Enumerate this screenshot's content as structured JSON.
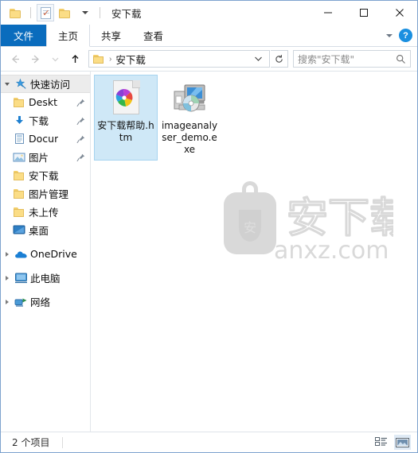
{
  "window": {
    "title": "安下载",
    "quick_access_toolbar": [
      {
        "name": "folder-icon",
        "label": ""
      },
      {
        "name": "properties-icon",
        "label": ""
      },
      {
        "name": "new-folder-icon",
        "label": ""
      },
      {
        "name": "customize-dropdown",
        "label": ""
      }
    ],
    "controls": {
      "minimize": "—",
      "maximize": "□",
      "close": "✕"
    }
  },
  "ribbon": {
    "tabs": [
      {
        "label": "文件",
        "state": "file"
      },
      {
        "label": "主页",
        "state": "active"
      },
      {
        "label": "共享",
        "state": "normal"
      },
      {
        "label": "查看",
        "state": "normal"
      }
    ],
    "collapse_label": "",
    "help_label": "?"
  },
  "address": {
    "back_label": "←",
    "forward_label": "→",
    "history_label": "⌄",
    "up_label": "↑",
    "separator": "›",
    "crumb": "安下载",
    "dropdown_label": "⌄",
    "refresh_label": "↻"
  },
  "search": {
    "placeholder": "搜索\"安下载\"",
    "value": "",
    "icon": "search-icon"
  },
  "sidebar": {
    "items": [
      {
        "label": "快速访问",
        "icon": "star-pin-icon",
        "expander": "down",
        "indent": false,
        "pinned": false,
        "highlight": true
      },
      {
        "label": "Deskt",
        "icon": "folder-icon",
        "expander": "none",
        "indent": true,
        "pinned": true,
        "highlight": false
      },
      {
        "label": "下载",
        "icon": "download-arrow-icon",
        "expander": "none",
        "indent": true,
        "pinned": true,
        "highlight": false
      },
      {
        "label": "Docur",
        "icon": "documents-icon",
        "expander": "none",
        "indent": true,
        "pinned": true,
        "highlight": false
      },
      {
        "label": "图片",
        "icon": "pictures-icon",
        "expander": "none",
        "indent": true,
        "pinned": true,
        "highlight": false
      },
      {
        "label": "安下载",
        "icon": "folder-icon",
        "expander": "none",
        "indent": true,
        "pinned": false,
        "highlight": false
      },
      {
        "label": "图片管理",
        "icon": "folder-icon",
        "expander": "none",
        "indent": true,
        "pinned": false,
        "highlight": false
      },
      {
        "label": "未上传",
        "icon": "folder-icon",
        "expander": "none",
        "indent": true,
        "pinned": false,
        "highlight": false
      },
      {
        "label": "桌面",
        "icon": "desktop-icon",
        "expander": "none",
        "indent": true,
        "pinned": false,
        "highlight": false
      },
      {
        "label": "OneDrive",
        "icon": "onedrive-cloud-icon",
        "expander": "right",
        "indent": false,
        "pinned": false,
        "highlight": false
      },
      {
        "label": "此电脑",
        "icon": "this-pc-icon",
        "expander": "right",
        "indent": false,
        "pinned": false,
        "highlight": false
      },
      {
        "label": "网络",
        "icon": "network-icon",
        "expander": "right",
        "indent": false,
        "pinned": false,
        "highlight": false
      }
    ]
  },
  "files": [
    {
      "name": "安下载帮助.htm",
      "icon": "html-document-pinwheel-icon",
      "selected": true
    },
    {
      "name": "imageanalyser_demo.exe",
      "icon": "application-monitor-disc-icon",
      "selected": false
    }
  ],
  "watermark": {
    "text": "安下载",
    "domain": "anxz.com",
    "badge_char": "安",
    "color": "#d8d8d8"
  },
  "statusbar": {
    "item_count": "2 个项目",
    "views": [
      {
        "name": "details-view-button",
        "active": false
      },
      {
        "name": "large-icons-view-button",
        "active": true
      }
    ]
  },
  "colors": {
    "accent": "#0a6cbd",
    "selection": "#cfe8f7",
    "folder": "#fbdd86",
    "window_border": "#7da2ce"
  }
}
